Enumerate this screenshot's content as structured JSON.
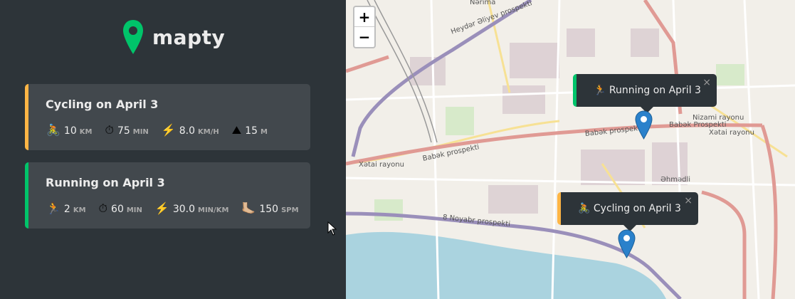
{
  "brand": {
    "name": "mapty"
  },
  "workouts": [
    {
      "type": "cycling",
      "title": "Cycling on April 3",
      "details": [
        {
          "icon": "🚴",
          "value": "10",
          "unit": "km"
        },
        {
          "icon": "⏱",
          "value": "75",
          "unit": "min"
        },
        {
          "icon": "⚡️",
          "value": "8.0",
          "unit": "km/h"
        },
        {
          "icon": "⛰",
          "value": "15",
          "unit": "m"
        }
      ]
    },
    {
      "type": "running",
      "title": "Running on April 3",
      "details": [
        {
          "icon": "🏃",
          "value": "2",
          "unit": "km"
        },
        {
          "icon": "⏱",
          "value": "60",
          "unit": "min"
        },
        {
          "icon": "⚡️",
          "value": "30.0",
          "unit": "min/km"
        },
        {
          "icon": "🦶🏼",
          "value": "150",
          "unit": "spm"
        }
      ]
    }
  ],
  "map": {
    "zoom_in": "+",
    "zoom_out": "−",
    "popups": [
      {
        "type": "running",
        "text": "🏃 Running on April 3",
        "close": "×"
      },
      {
        "type": "cycling",
        "text": "🚴 Cycling on April 3",
        "close": "×"
      }
    ],
    "labels": {
      "heydar": "Heydər Əliyev prospekti",
      "babak1": "Babək prospekti",
      "babak2": "Babək prospekti",
      "babak3": "Babək Prospekti",
      "xatai1": "Xətai rayonu",
      "xatai2": "Xətai rayonu",
      "nizami": "Nizami rayonu",
      "ehmedli": "Əhmədli",
      "noyabr": "8 Noyabr prospekti",
      "narimanov": "Nərima"
    }
  },
  "colors": {
    "running": "#00c46a",
    "cycling": "#ffb545",
    "panel": "#2d3439",
    "card": "#42484d"
  }
}
